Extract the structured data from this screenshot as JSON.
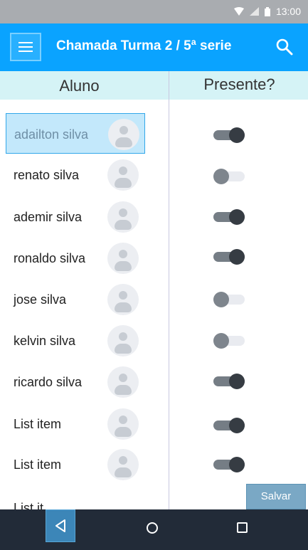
{
  "status_bar": {
    "time": "13:00",
    "icons": [
      "wifi-icon",
      "signal-icon",
      "battery-icon"
    ]
  },
  "app_bar": {
    "title": "Chamada Turma 2 / 5ª serie",
    "menu_icon": "hamburger-menu-icon",
    "search_icon": "search-icon"
  },
  "table": {
    "headers": {
      "student": "Aluno",
      "present": "Presente?"
    },
    "rows": [
      {
        "name": "adailton silva",
        "present": true,
        "selected": true
      },
      {
        "name": "renato silva",
        "present": false
      },
      {
        "name": "ademir silva",
        "present": true
      },
      {
        "name": "ronaldo silva",
        "present": true
      },
      {
        "name": "jose silva",
        "present": false
      },
      {
        "name": "kelvin silva",
        "present": false
      },
      {
        "name": "ricardo silva",
        "present": true
      },
      {
        "name": "List item",
        "present": true
      },
      {
        "name": "List item",
        "present": true
      },
      {
        "name": "List it"
      }
    ]
  },
  "actions": {
    "save_label": "Salvar"
  },
  "nav_bar": {
    "icons": [
      "back-icon",
      "home-icon",
      "recent-apps-icon"
    ]
  },
  "colors": {
    "app_bar": "#0aa3ff",
    "header": "#d5f3f6",
    "nav_bar": "#222b38",
    "save_button": "#7aa8c5"
  }
}
